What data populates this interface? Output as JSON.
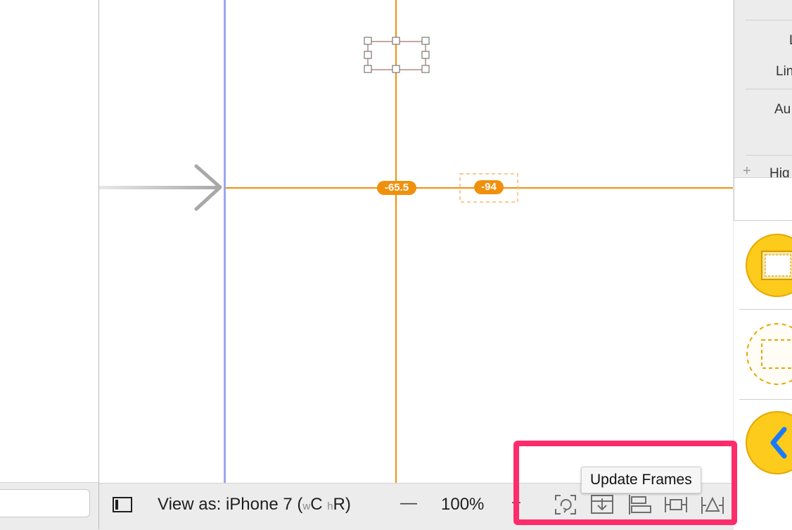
{
  "canvas": {
    "constraint_left_value": "-65.5",
    "constraint_right_value": "-94"
  },
  "bottom_bar": {
    "view_as_label": "View as: iPhone 7 (",
    "size_class_w_prefix": "w",
    "size_class_w_value": "C",
    "size_class_h_prefix": "h",
    "size_class_h_value": "R",
    "size_class_close": ")",
    "zoom_out_glyph": "—",
    "zoom_level": "100%",
    "zoom_in_glyph": "+"
  },
  "tooltip": {
    "text": "Update Frames"
  },
  "inspector": {
    "row1_text": "L",
    "row2_text": "Lin",
    "row3_text": "Au",
    "row4_text": "Hig"
  },
  "colors": {
    "constraint_orange": "#f0900c",
    "highlight_pink": "#fe2c6b",
    "guide_blue": "#9aa6f0",
    "library_yellow": "#fccb1b"
  },
  "icons": [
    "sidebar-toggle-icon",
    "update-frames-icon",
    "embed-in-stack-icon",
    "align-icon",
    "add-constraints-icon",
    "resolve-issues-icon",
    "object-grid-icon",
    "filter-icon",
    "back-chevron-icon"
  ]
}
